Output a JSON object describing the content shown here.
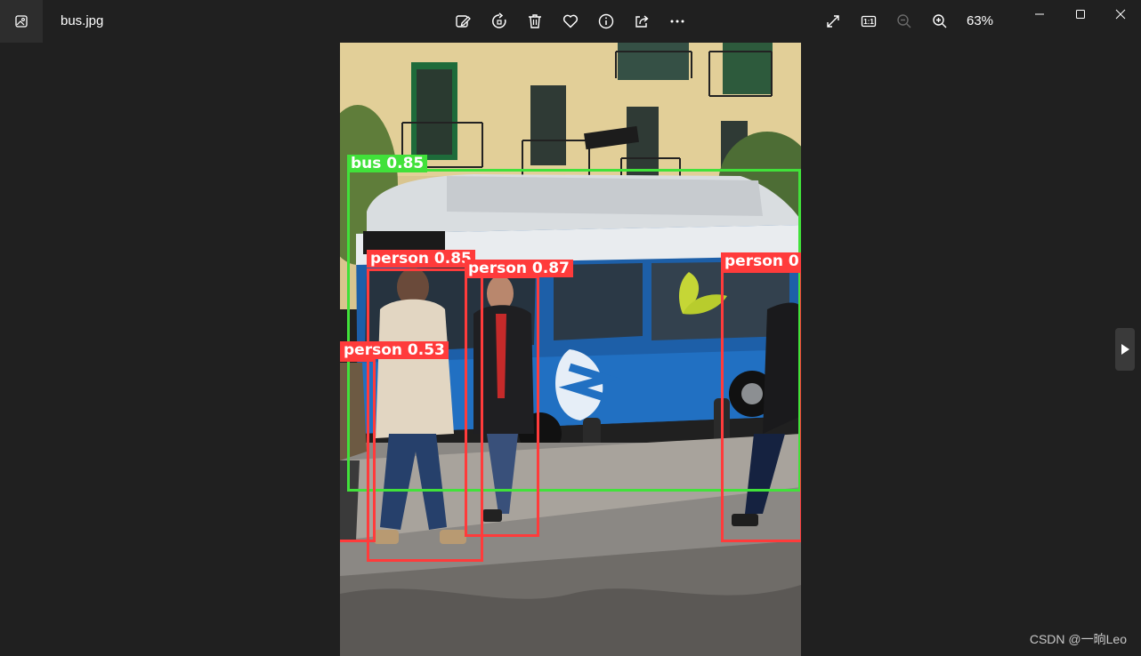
{
  "window": {
    "file_name": "bus.jpg",
    "zoom_level": "63%"
  },
  "toolbar": {
    "edit_icon": "edit-image-icon",
    "rotate_icon": "rotate-icon",
    "delete_icon": "delete-icon",
    "favorite_icon": "heart-icon",
    "info_icon": "info-icon",
    "share_icon": "share-icon",
    "more_icon": "more-icon",
    "fullscreen_icon": "expand-icon",
    "actual_size_label": "1:1",
    "zoom_out_icon": "zoom-out-icon",
    "zoom_in_icon": "zoom-in-icon"
  },
  "detections": [
    {
      "label": "bus 0.85",
      "class": "bus"
    },
    {
      "label": "person 0.85",
      "class": "person"
    },
    {
      "label": "person 0.87",
      "class": "person"
    },
    {
      "label": "person 0",
      "class": "person"
    },
    {
      "label": "person 0.53",
      "class": "person"
    }
  ],
  "colors": {
    "bus_box": "#41e13a",
    "person_box": "#ff3b3b",
    "background": "#202020"
  },
  "watermark": "CSDN @一晌Leo"
}
